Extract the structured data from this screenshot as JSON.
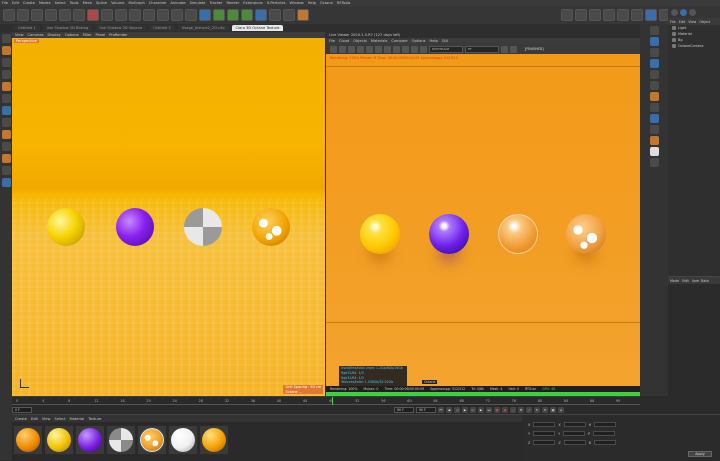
{
  "menu": [
    "File",
    "Edit",
    "Create",
    "Modes",
    "Select",
    "Tools",
    "Mesh",
    "Spline",
    "Volume",
    "MoGraph",
    "Character",
    "Animate",
    "Simulate",
    "Tracker",
    "Render",
    "Extensions",
    "X-Particles",
    "Window",
    "Help",
    "Octane",
    "RSTools"
  ],
  "tabs": [
    "Untitled 1",
    "Use Shadow 2D Baking",
    "Use Shadow 3D Volume",
    "Untitled 2",
    "Usage_texture2_2D.c4d",
    "Clara 3D Octane Texture"
  ],
  "viewport_left": {
    "menu": [
      "View",
      "Cameras",
      "Display",
      "Options",
      "Filter",
      "Panel",
      "ProRender"
    ],
    "header_label": "Perspective",
    "corner_labels": [
      "Grid Spacing : 50 cm",
      "Octane ..."
    ]
  },
  "viewport_right": {
    "title": "Live Viewer 2020.1.3-R7 (127 days left)",
    "menu": [
      "File",
      "Cloud",
      "Objects",
      "Materials",
      "Compare",
      "Options",
      "Help",
      "GUI"
    ],
    "mode_label": "PATHTRACE",
    "mode_value": "PT",
    "finished_label": "[FINISHED]",
    "top_stat": "Rendering: 100% Ms/sec: 0 Time: 00:00:09/00:00:09 Spp/maxspp: 512/512",
    "hud": [
      "Used/free/total vram: 1.2Gb/8Gb/16Gb",
      "Rgb32/64: 1/0",
      "Rgb32/64: 1/0",
      "Textures/total: 1.036Gb/52.92Gb"
    ],
    "hud_tag": "Octane",
    "status": {
      "rendering": "Rendering: 100%",
      "mssec": "Ms/sec: 0",
      "time": "Time: 00:00:09/00:00:09",
      "spp": "Spp/maxspp: 512/512",
      "tri": "Tri: 0/8k",
      "mesh": "Mesh: 4",
      "hair": "Hair: 0",
      "rtx": "RTX:on",
      "gpu": "GPU: 46"
    },
    "progress": 1.0
  },
  "object_manager": {
    "menu": [
      "File",
      "Edit",
      "View",
      "Object"
    ],
    "objects": [
      "Light",
      "Material",
      "Bg",
      "OctaneCamera"
    ]
  },
  "attribute_manager": {
    "menu": [
      "Mode",
      "Edit",
      "User Data"
    ]
  },
  "timeline": {
    "ticks": [
      "0",
      "4",
      "8",
      "12",
      "16",
      "20",
      "24",
      "28",
      "32",
      "36",
      "40",
      "44",
      "48",
      "52",
      "56",
      "60",
      "64",
      "68",
      "72",
      "76",
      "80",
      "84",
      "88",
      "90"
    ],
    "current_frame": "0 F",
    "start_field": "0 F",
    "end_field": "90 F",
    "end_field2": "90 F",
    "end_frame_label": "90 F"
  },
  "material_manager": {
    "menu": [
      "Create",
      "Edit",
      "View",
      "Select",
      "Material",
      "Texture"
    ],
    "materials": [
      {
        "color": "#f08a00"
      },
      {
        "color": "#f2c200"
      },
      {
        "color": "#7a1fe0"
      },
      {
        "color": "#bfbfbf"
      },
      {
        "color": "#f0a030"
      },
      {
        "color": "#f0f0f0"
      },
      {
        "color": "#f5a000"
      }
    ]
  },
  "coordinates": {
    "labels": [
      "X",
      "Y",
      "Z"
    ],
    "apply": "Apply"
  },
  "spheres_left": [
    {
      "color": "#f5d400",
      "type": "yellow"
    },
    {
      "color": "#8a1ff0",
      "type": "purple"
    },
    {
      "color": "#c8c8c8",
      "type": "checker"
    },
    {
      "color": "#f2a400",
      "type": "marble"
    }
  ],
  "spheres_right": [
    {
      "color": "#ffcf10",
      "type": "yellow"
    },
    {
      "color": "#7a2ef0",
      "type": "purple"
    },
    {
      "color": "#f6c07a",
      "type": "glass"
    },
    {
      "color": "#f7d0a0",
      "type": "marble"
    }
  ]
}
